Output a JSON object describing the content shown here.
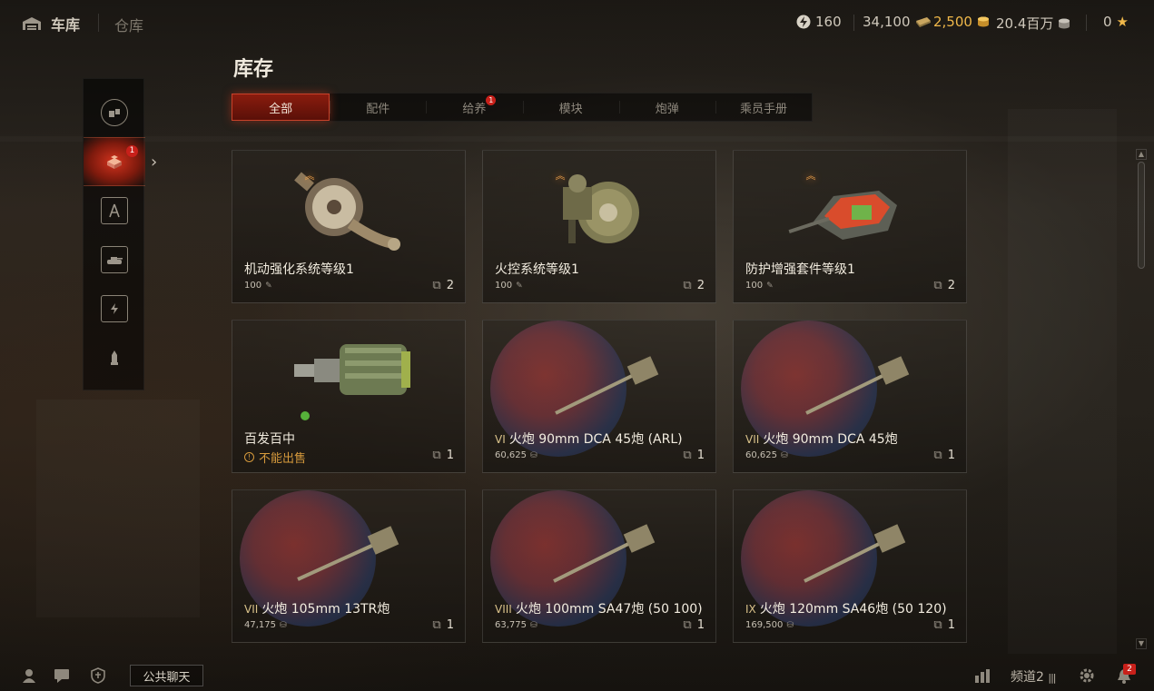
{
  "topbar": {
    "garage_label": "车库",
    "depot_label": "仓库",
    "free_xp": "160",
    "credits_a": "34,100",
    "gold": "2,500",
    "credits_b": "20.4百万",
    "stars": "0"
  },
  "page": {
    "title": "库存"
  },
  "sidebar": {
    "badge": "1",
    "items": [
      {
        "icon": "consumables-icon"
      },
      {
        "icon": "inventory-crate-icon",
        "active": true
      },
      {
        "icon": "compass-icon"
      },
      {
        "icon": "tank-icon"
      },
      {
        "icon": "crew-icon"
      },
      {
        "icon": "shell-icon"
      }
    ]
  },
  "tabs": [
    {
      "label": "全部",
      "active": true
    },
    {
      "label": "配件"
    },
    {
      "label": "给养",
      "badge": "1"
    },
    {
      "label": "模块"
    },
    {
      "label": "炮弹"
    },
    {
      "label": "乘员手册"
    }
  ],
  "cards": [
    {
      "name": "机动强化系统等级1",
      "price": "100",
      "count": "2",
      "type": "equipment",
      "upgrade": true
    },
    {
      "name": "火控系统等级1",
      "price": "100",
      "count": "2",
      "type": "equipment",
      "upgrade": true
    },
    {
      "name": "防护增强套件等级1",
      "price": "100",
      "count": "2",
      "type": "equipment",
      "upgrade": true
    },
    {
      "name": "百发百中",
      "warning": "不能出售",
      "count": "1",
      "type": "booster"
    },
    {
      "tier": "VI",
      "name": "火炮 90mm DCA 45炮 (ARL)",
      "price": "60,625",
      "count": "1",
      "type": "gun"
    },
    {
      "tier": "VII",
      "name": "火炮 90mm DCA 45炮",
      "price": "60,625",
      "count": "1",
      "type": "gun"
    },
    {
      "tier": "VII",
      "name": "火炮 105mm 13TR炮",
      "price": "47,175",
      "count": "1",
      "type": "gun"
    },
    {
      "tier": "VIII",
      "name": "火炮 100mm SA47炮 (50 100)",
      "price": "63,775",
      "count": "1",
      "type": "gun"
    },
    {
      "tier": "IX",
      "name": "火炮 120mm SA46炮 (50 120)",
      "price": "169,500",
      "count": "1",
      "type": "gun"
    }
  ],
  "bottombar": {
    "chat_label": "公共聊天",
    "channel": "频道2",
    "notification_count": "2"
  },
  "colors": {
    "accent_red": "#c8201a",
    "gold": "#f0b84a",
    "warning": "#d69a3c",
    "tier": "#d9c28a"
  }
}
